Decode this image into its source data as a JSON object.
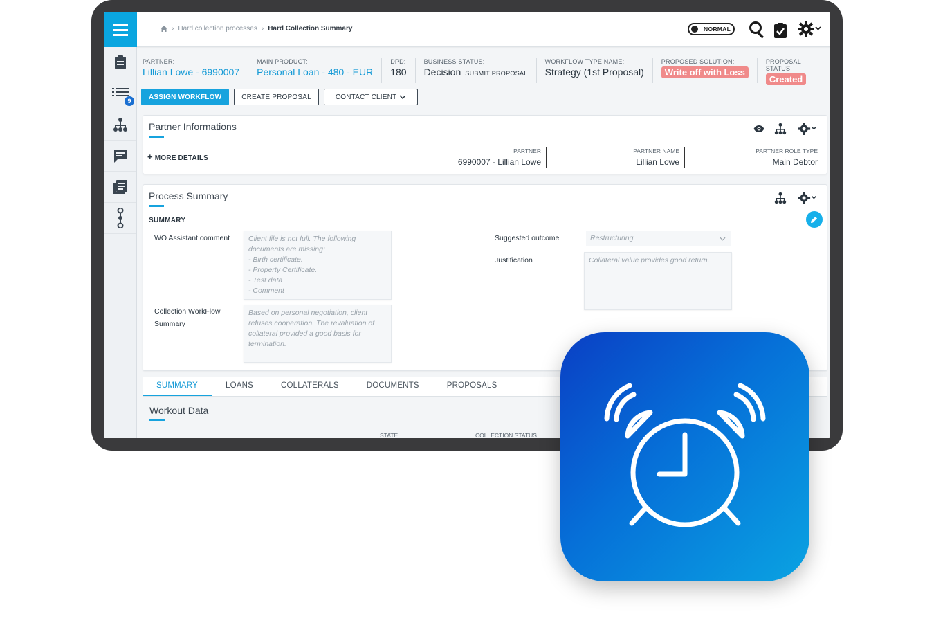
{
  "breadcrumb": {
    "home_icon": "home-icon",
    "items": [
      "Hard collection processes",
      "Hard Collection Summary"
    ]
  },
  "topbar": {
    "mode_label": "NORMAL",
    "icons": [
      "search-icon",
      "clipboard-check-icon",
      "gear-icon"
    ]
  },
  "rail": {
    "icons": [
      "menu-icon",
      "clipboard-icon",
      "list-icon",
      "hierarchy-icon",
      "comment-icon",
      "documents-icon",
      "workflow-icon"
    ],
    "badge": "9"
  },
  "header": {
    "partner_label": "PARTNER:",
    "partner_value": "Lillian Lowe - 6990007",
    "product_label": "MAIN PRODUCT:",
    "product_value": "Personal Loan - 480 - EUR",
    "dpd_label": "DPD:",
    "dpd_value": "180",
    "business_label": "BUSINESS STATUS:",
    "business_value": "Decision",
    "business_sub": "SUBMIT PROPOSAL",
    "workflow_label": "WORKFLOW TYPE NAME:",
    "workflow_value": "Strategy (1st Proposal)",
    "solution_label": "PROPOSED SOLUTION:",
    "solution_value": "Write off with Loss",
    "status_label": "PROPOSAL STATUS:",
    "status_value": "Created"
  },
  "actions": {
    "assign": "ASSIGN WORKFLOW",
    "create": "CREATE PROPOSAL",
    "contact": "CONTACT CLIENT"
  },
  "partner_card": {
    "title": "Partner Informations",
    "more": "MORE DETAILS",
    "partner_label": "PARTNER",
    "partner_value": "6990007 - Lillian Lowe",
    "name_label": "PARTNER NAME",
    "name_value": "Lillian Lowe",
    "role_label": "PARTNER ROLE TYPE",
    "role_value": "Main Debtor"
  },
  "process_card": {
    "title": "Process Summary",
    "section": "SUMMARY",
    "wo_label": "WO Assistant comment",
    "wo_text": "Client file is not full. The following\ndocuments are missing:\n- Birth certificate.\n- Property Certificate.\n- Test data\n- Comment",
    "cws_label": "Collection WorkFlow\nSummary",
    "cws_text": "Based on personal negotiation, client\nrefuses cooperation. The revaluation of\ncollateral provided a good basis for\ntermination.",
    "outcome_label": "Suggested outcome",
    "outcome_value": "Restructuring",
    "justification_label": "Justification",
    "justification_text": "Collateral value provides good return."
  },
  "tabs": [
    "SUMMARY",
    "LOANS",
    "COLLATERALS",
    "DOCUMENTS",
    "PROPOSALS"
  ],
  "workout": {
    "title": "Workout Data",
    "col_state": "STATE",
    "col_collection_status": "COLLECTION STATUS"
  },
  "app_icon": {
    "name": "alarm-clock-icon",
    "gradient": [
      "#0a3fc4",
      "#0aa3e2"
    ]
  }
}
